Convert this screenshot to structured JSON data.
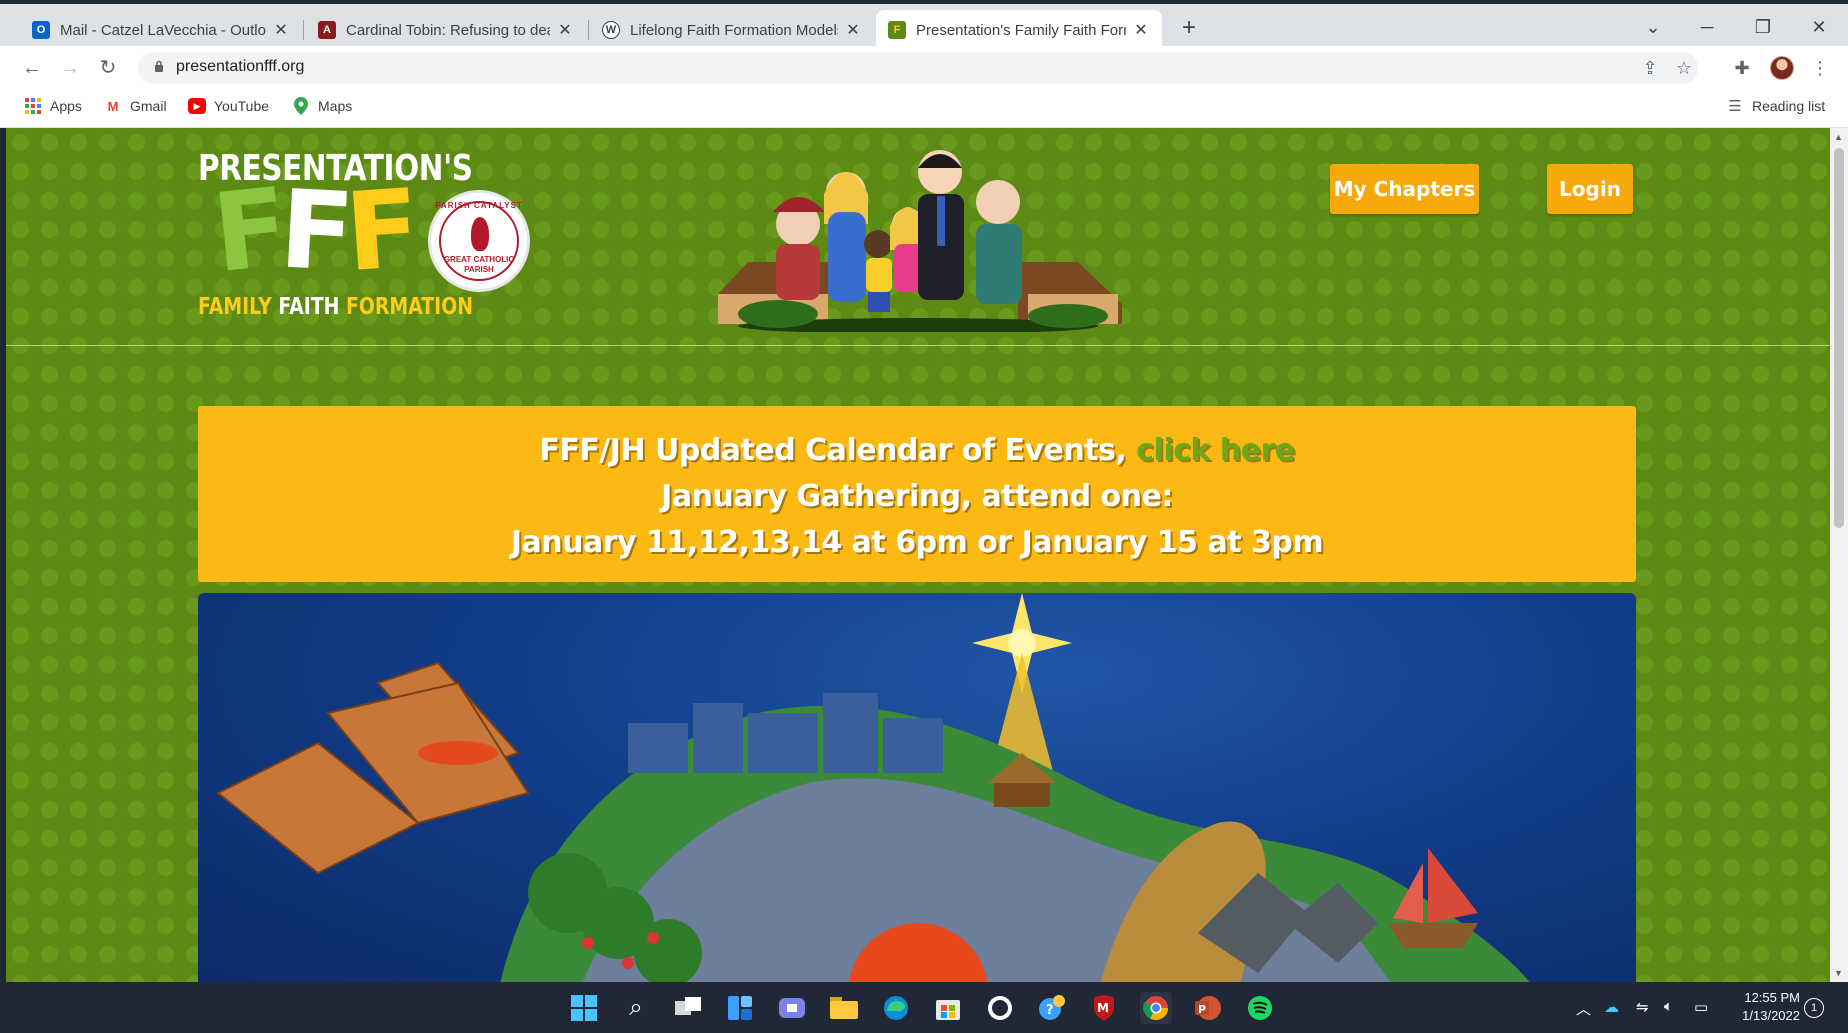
{
  "browser": {
    "tabs": [
      {
        "title": "Mail - Catzel LaVecchia - Outlook",
        "icon": "outlook-icon",
        "active": false
      },
      {
        "title": "Cardinal Tobin: Refusing to deal w",
        "icon": "america-magazine-icon",
        "active": false
      },
      {
        "title": "Lifelong Faith Formation Models",
        "icon": "wordpress-icon",
        "active": false
      },
      {
        "title": "Presentation's Family Faith Forma",
        "icon": "fff-site-icon",
        "active": true
      }
    ],
    "new_tab_label": "+",
    "url": "presentationfff.org",
    "bookmarks": [
      {
        "label": "Apps",
        "icon": "apps-grid-icon"
      },
      {
        "label": "Gmail",
        "icon": "gmail-icon"
      },
      {
        "label": "YouTube",
        "icon": "youtube-icon"
      },
      {
        "label": "Maps",
        "icon": "maps-pin-icon"
      }
    ],
    "reading_list_label": "Reading list"
  },
  "page": {
    "logo": {
      "top": "PRESENTATION'S",
      "letters": [
        "F",
        "F",
        "F"
      ],
      "sub1": "FAMILY",
      "sub2": "FAITH",
      "sub3": "FORMATION"
    },
    "seal": {
      "top_text": "PARISH CATALYST",
      "bottom_text_1": "GREAT CATHOLIC",
      "bottom_text_2": "PARISH"
    },
    "nav": {
      "my_chapters": "My Chapters",
      "login": "Login"
    },
    "banner": {
      "line1": "FFF/JH Updated Calendar of Events, ",
      "line1_link": "click here",
      "line2": "January Gathering, attend one:",
      "line3": "January 11,12,13,14 at 6pm or January 15 at 3pm"
    },
    "colors": {
      "page_bg": "#5c8a14",
      "banner_bg": "#fdb913",
      "button_bg": "#f7a80b",
      "link_green": "#6ca81c"
    }
  },
  "taskbar": {
    "apps": [
      "windows-start-icon",
      "search-icon",
      "task-view-icon",
      "widgets-icon",
      "teams-chat-icon",
      "file-explorer-icon",
      "edge-icon",
      "store-icon",
      "github-icon",
      "tips-icon",
      "mcafee-icon",
      "chrome-icon",
      "powerpoint-icon",
      "spotify-icon"
    ],
    "time": "12:55 PM",
    "date": "1/13/2022",
    "notification_count": "1"
  }
}
